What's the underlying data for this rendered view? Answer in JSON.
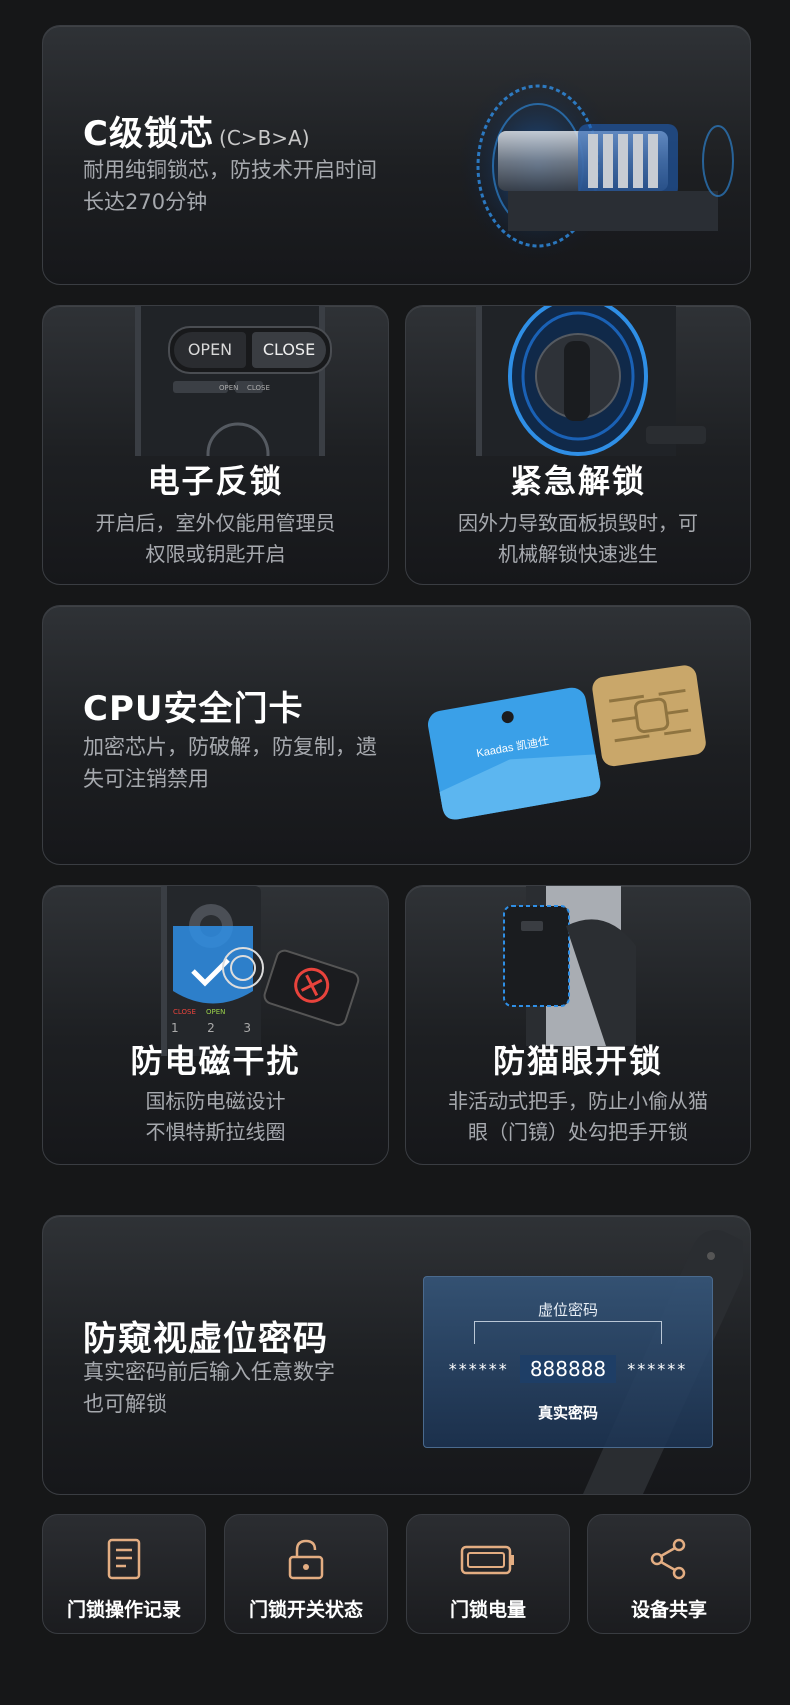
{
  "lock_core": {
    "title": "C级锁芯",
    "grade": "(C>B>A)",
    "desc_line1": "耐用纯铜锁芯，防技术开启时间",
    "desc_line2": "长达270分钟"
  },
  "electronic_lock": {
    "title": "电子反锁",
    "desc_line1": "开启后，室外仅能用管理员",
    "desc_line2": "权限或钥匙开启",
    "open_label": "OPEN",
    "close_label": "CLOSE",
    "mini_open": "OPEN",
    "mini_close": "CLOSE"
  },
  "emergency_unlock": {
    "title": "紧急解锁",
    "desc_line1": "因外力导致面板损毁时，可",
    "desc_line2": "机械解锁快速逃生"
  },
  "cpu_card": {
    "title": "CPU安全门卡",
    "desc_line1": "加密芯片，防破解，防复制，遗",
    "desc_line2": "失可注销禁用",
    "brand": "Kaadas 凯迪仕"
  },
  "anti_em": {
    "title": "防电磁干扰",
    "desc_line1": "国标防电磁设计",
    "desc_line2": "不惧特斯拉线圈",
    "keypad": [
      "1",
      "2",
      "3"
    ],
    "close_label": "CLOSE",
    "open_label": "OPEN"
  },
  "anti_cat_eye": {
    "title": "防猫眼开锁",
    "desc_line1": "非活动式把手，防止小偷从猫",
    "desc_line2": "眼（门镜）处勾把手开锁"
  },
  "virtual_pwd": {
    "title": "防窥视虚位密码",
    "desc_line1": "真实密码前后输入任意数字",
    "desc_line2": "也可解锁",
    "virtual_label": "虚位密码",
    "stars_left": "******",
    "real_code": "888888",
    "stars_right": "******",
    "real_label": "真实密码"
  },
  "bottom_buttons": [
    {
      "label": "门锁操作记录",
      "icon": "record-icon"
    },
    {
      "label": "门锁开关状态",
      "icon": "padlock-icon"
    },
    {
      "label": "门锁电量",
      "icon": "battery-icon"
    },
    {
      "label": "设备共享",
      "icon": "share-icon"
    }
  ],
  "colors": {
    "accent_blue": "#2f8fe6",
    "card_blue": "#3aa0e8",
    "chip_gold": "#c9a76a",
    "warning_red": "#e8433c",
    "icon_orange": "#e3ad82"
  }
}
